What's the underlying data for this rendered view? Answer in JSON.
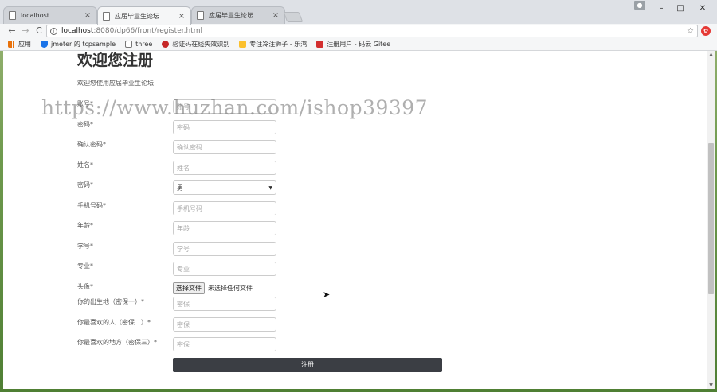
{
  "browser": {
    "tabs": [
      {
        "label": "localhost",
        "active": false
      },
      {
        "label": "应届毕业生论坛",
        "active": true
      },
      {
        "label": "应届毕业生论坛",
        "active": false
      }
    ],
    "tab_close": "×",
    "window_controls": {
      "minimize": "–",
      "maximize": "□",
      "close": "✕"
    },
    "nav": {
      "back": "←",
      "forward": "→",
      "reload": "C"
    },
    "address": {
      "host": "localhost",
      "path": ":8080/dp66/front/register.html"
    },
    "star": "☆",
    "bookmarks": [
      {
        "label": "应用",
        "icon": "apps-grid-icon",
        "color": "#e8710a"
      },
      {
        "label": "jmeter 的 tcpsample",
        "icon": "shield-icon",
        "color": "#1a73e8"
      },
      {
        "label": "three",
        "icon": "page-icon",
        "color": "#ffffff"
      },
      {
        "label": "验证码在线失效识别",
        "icon": "bug-icon",
        "color": "#c62828"
      },
      {
        "label": "专注冷注狮子 - 乐鸿",
        "icon": "lion-icon",
        "color": "#fbc02d"
      },
      {
        "label": "注册用户 - 码云 Gitee",
        "icon": "gitee-icon",
        "color": "#d32f2f"
      }
    ]
  },
  "page": {
    "title": "欢迎您注册",
    "subtitle": "欢迎您使用应届毕业生论坛",
    "fields": [
      {
        "label": "账号*",
        "placeholder": "账号",
        "type": "text"
      },
      {
        "label": "密码*",
        "placeholder": "密码",
        "type": "text"
      },
      {
        "label": "确认密码*",
        "placeholder": "确认密码",
        "type": "text"
      },
      {
        "label": "姓名*",
        "placeholder": "姓名",
        "type": "text"
      },
      {
        "label": "密码*",
        "value": "男",
        "type": "select"
      },
      {
        "label": "手机号码*",
        "placeholder": "手机号码",
        "type": "text"
      },
      {
        "label": "年龄*",
        "placeholder": "年龄",
        "type": "text"
      },
      {
        "label": "学号*",
        "placeholder": "学号",
        "type": "text"
      },
      {
        "label": "专业*",
        "placeholder": "专业",
        "type": "text"
      },
      {
        "label": "头像*",
        "type": "file",
        "button": "选择文件",
        "status": "未选择任何文件"
      },
      {
        "label": "你的出生地（密保一）*",
        "placeholder": "密保",
        "type": "text"
      },
      {
        "label": "你最喜欢的人（密保二）*",
        "placeholder": "密保",
        "type": "text"
      },
      {
        "label": "你最喜欢的地方（密保三）*",
        "placeholder": "密保",
        "type": "text"
      }
    ],
    "submit_label": "注册",
    "select_arrow": "▼"
  },
  "watermark": "https://www.huzhan.com/ishop39397",
  "colors": {
    "submit_bg": "#3b3e44",
    "chrome_bg": "#dee1e6"
  }
}
